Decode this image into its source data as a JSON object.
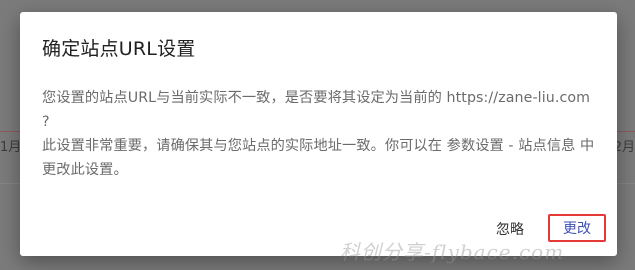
{
  "background": {
    "left_edge_text": "1月",
    "right_edge_text": "2月"
  },
  "dialog": {
    "title": "确定站点URL设置",
    "body_line1": "您设置的站点URL与当前实际不一致，是否要将其设定为当前的 https://zane-liu.com ?",
    "body_line2": "此设置非常重要，请确保其与您站点的实际地址一致。你可以在 参数设置 - 站点信息 中更改此设置。",
    "ignore_label": "忽略",
    "change_label": "更改"
  },
  "watermark": "科创分享-flybace.com",
  "colors": {
    "accent": "#3f51b5",
    "highlight_border": "#e53935",
    "overlay": "#7b7b7b"
  }
}
